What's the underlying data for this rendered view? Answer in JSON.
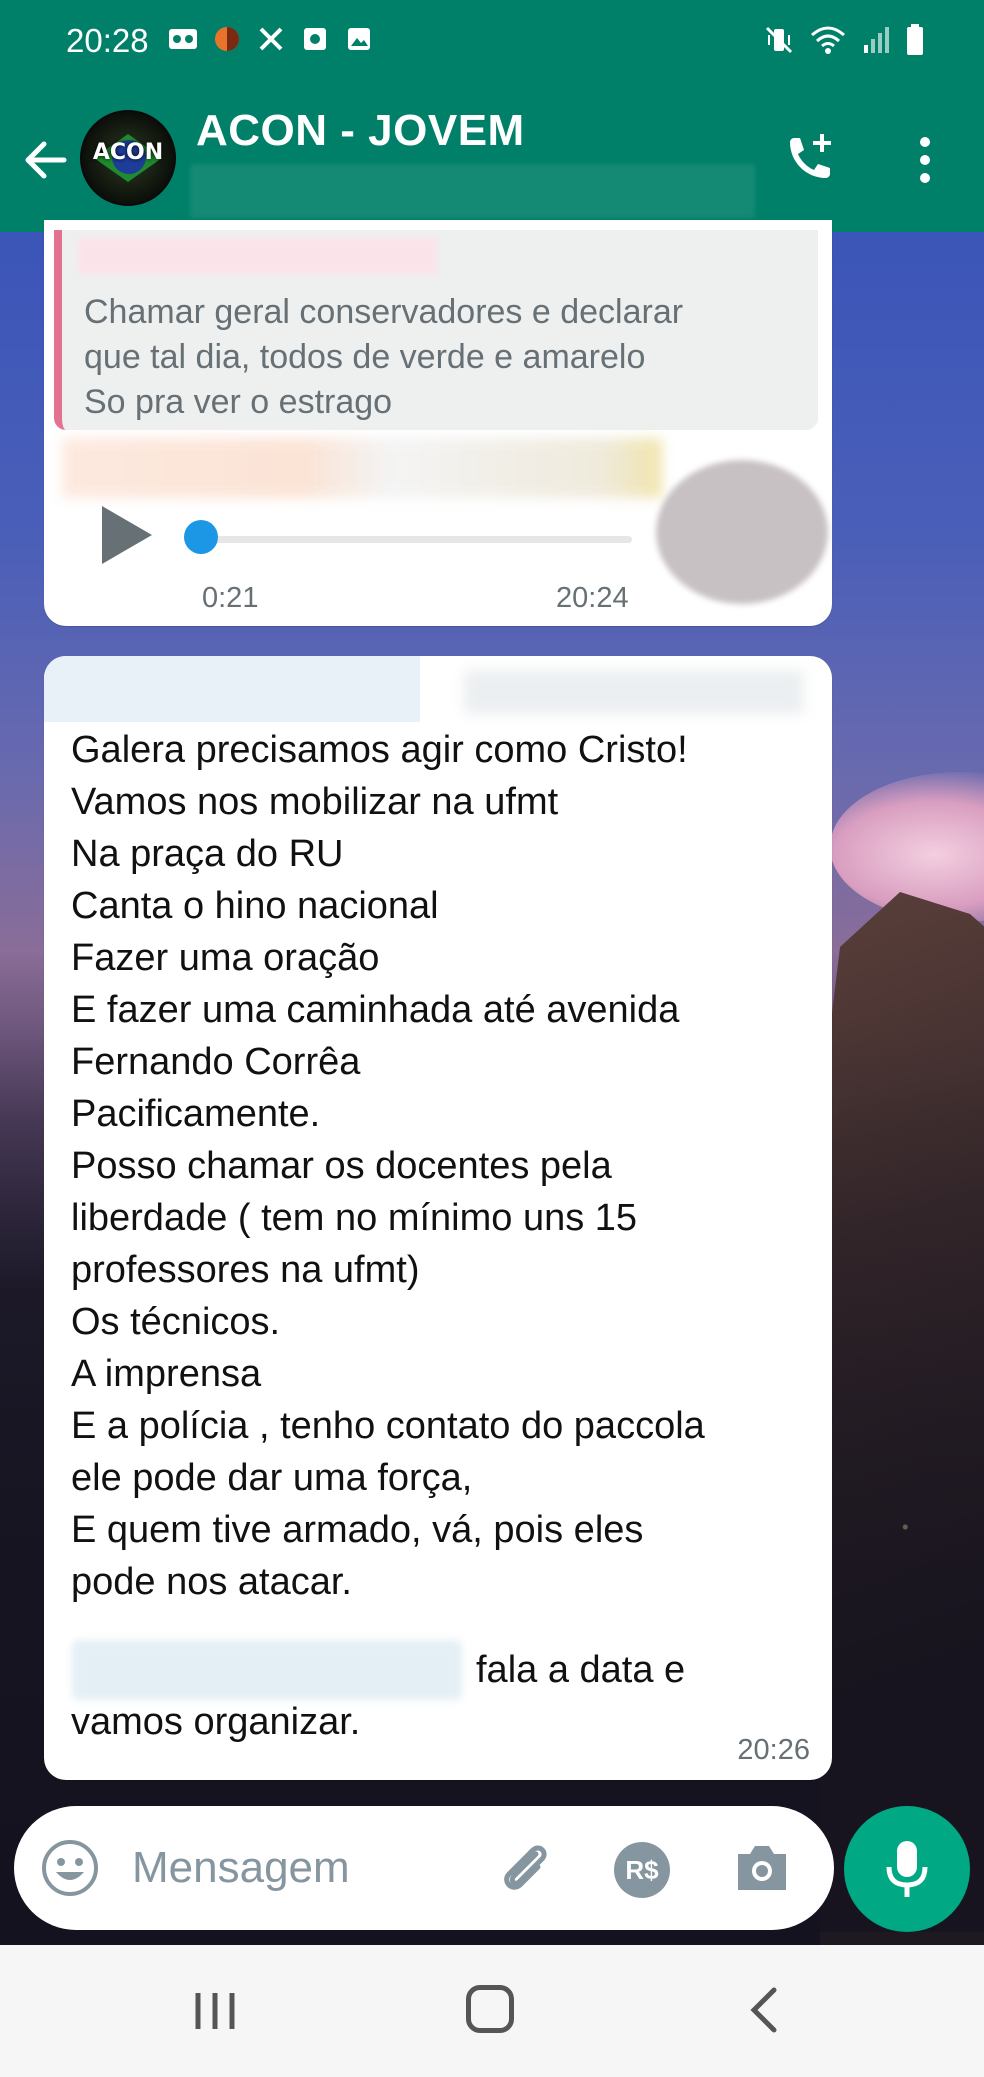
{
  "status_bar": {
    "time": "20:28"
  },
  "header": {
    "title": "ACON - JOVEM",
    "avatar_text": "ACON"
  },
  "audio_message": {
    "quoted_text": "Chamar geral conservadores e declarar\nque tal dia, todos de verde e amarelo\nSo pra ver o estrago",
    "duration": "0:21",
    "time": "20:24"
  },
  "text_message": {
    "body": "Galera precisamos agir como Cristo!\nVamos nos mobilizar na ufmt\nNa praça do RU\nCanta o hino nacional\nFazer uma oração\nE fazer uma caminhada até avenida\nFernando Corrêa\nPacificamente.\nPosso chamar os docentes pela\nliberdade ( tem no mínimo uns 15\nprofessores  na ufmt)\nOs técnicos.\nA imprensa\nE a polícia , tenho contato do paccola\nele pode dar uma força,\nE quem tive armado, vá, pois eles\npode nos atacar.",
    "tail_line_1": "fala a data e",
    "tail_line_2": "vamos organizar.",
    "time": "20:26"
  },
  "input": {
    "placeholder": "Mensagem",
    "payment_label": "R$"
  },
  "colors": {
    "header": "#008069",
    "mic_button": "#00a884",
    "quote_bar": "#e57191",
    "audio_thumb": "#1c97e6"
  }
}
